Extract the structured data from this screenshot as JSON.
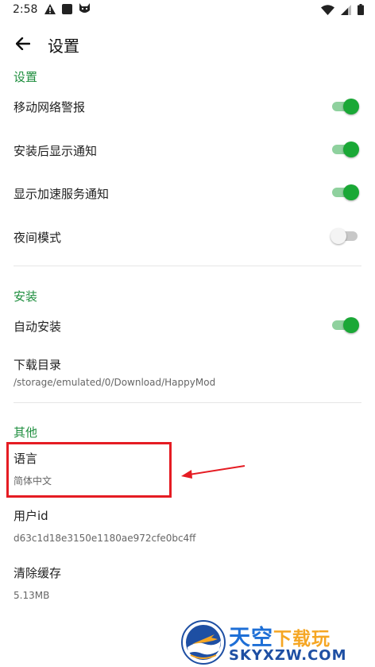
{
  "status_bar": {
    "time": "2:58"
  },
  "toolbar": {
    "title": "设置"
  },
  "sections": {
    "settings": {
      "header": "设置",
      "items": [
        {
          "label": "移动网络警报",
          "enabled": true
        },
        {
          "label": "安装后显示通知",
          "enabled": true
        },
        {
          "label": "显示加速服务通知",
          "enabled": true
        },
        {
          "label": "夜间模式",
          "enabled": false
        }
      ]
    },
    "install": {
      "header": "安装",
      "auto_install": {
        "label": "自动安装",
        "enabled": true
      },
      "download_dir": {
        "label": "下载目录",
        "value": "/storage/emulated/0/Download/HappyMod"
      }
    },
    "other": {
      "header": "其他",
      "language": {
        "label": "语言",
        "value": "简体中文"
      },
      "user_id": {
        "label": "用户id",
        "value": "d63c1d18e3150e1180ae972cfe0bc4ff"
      },
      "clear_cache": {
        "label": "清除缓存",
        "value": "5.13MB"
      }
    }
  },
  "watermark": {
    "text_main": "天空",
    "text_accent": "下载玩",
    "text_domain": "SKYXZW.COM"
  },
  "colors": {
    "accent_green": "#1aa836",
    "section_header": "#1e8e3e",
    "highlight_red": "#e51c23"
  }
}
